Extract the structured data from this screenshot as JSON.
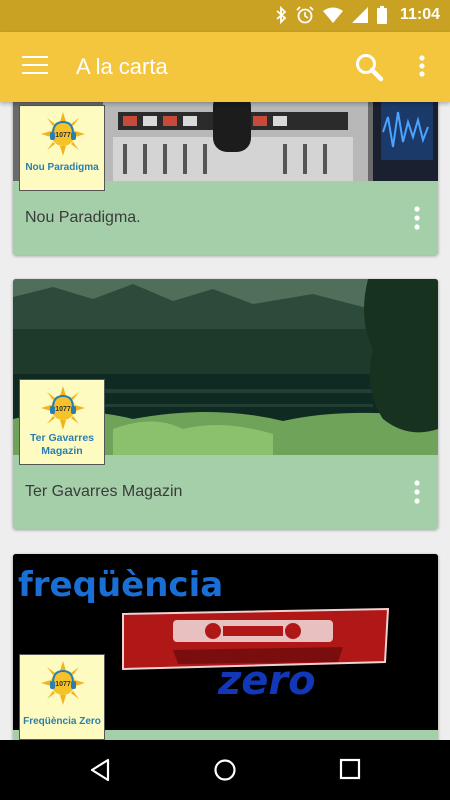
{
  "status_bar": {
    "time": "11:04",
    "icons": [
      "bluetooth-icon",
      "alarm-icon",
      "wifi-icon",
      "signal-icon",
      "battery-icon"
    ]
  },
  "app_bar": {
    "title": "A la carta",
    "icons": [
      "menu-icon",
      "search-icon",
      "more-vert-icon"
    ]
  },
  "colors": {
    "status_bar": "#c9a224",
    "app_bar": "#f4c63e",
    "card_footer": "#a5cfa8",
    "logo_bg": "#fdfbc0",
    "logo_text": "#2a7fb0"
  },
  "cards": [
    {
      "logo_number": "1077",
      "logo_label": "Nou Paradigma",
      "title": "Nou Paradigma."
    },
    {
      "logo_number": "1077",
      "logo_label": "Ter Gavarres Magazin",
      "title": "Ter Gavarres Magazin"
    },
    {
      "logo_number": "1077",
      "logo_label": "Freqüència Zero",
      "title": "",
      "banner_line1": "freqüència",
      "banner_line2": "zero"
    }
  ],
  "nav_bar": {
    "icons": [
      "back-icon",
      "home-icon",
      "recents-icon"
    ]
  }
}
